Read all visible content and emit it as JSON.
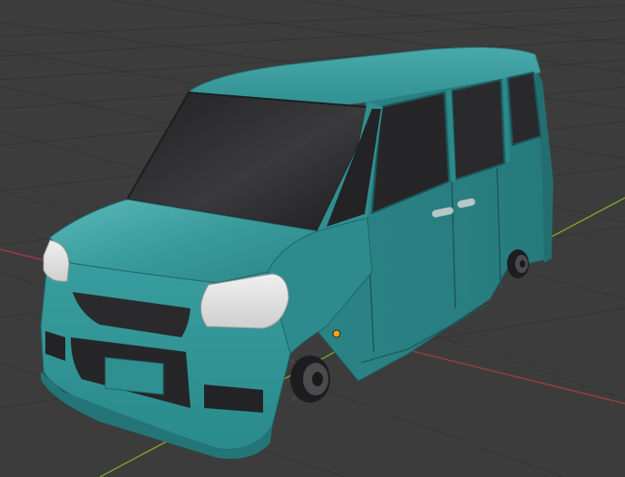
{
  "viewport": {
    "background_color": "#3c3c3c",
    "grid_line_color": "#333333",
    "x_axis_color": "#9b3a43",
    "y_axis_color": "#7aa02b",
    "grid_visible": true
  },
  "object": {
    "kind": "van-body-mesh",
    "body_color": "#2f8f91",
    "body_highlight_color": "#56b3b4",
    "body_shadow_color": "#1f6265",
    "glass_color": "#2a2a2c",
    "light_color": "#e3e3e3",
    "origin_marker_color": "#f2a51a"
  },
  "icons": {
    "origin": "origin-dot-icon"
  }
}
